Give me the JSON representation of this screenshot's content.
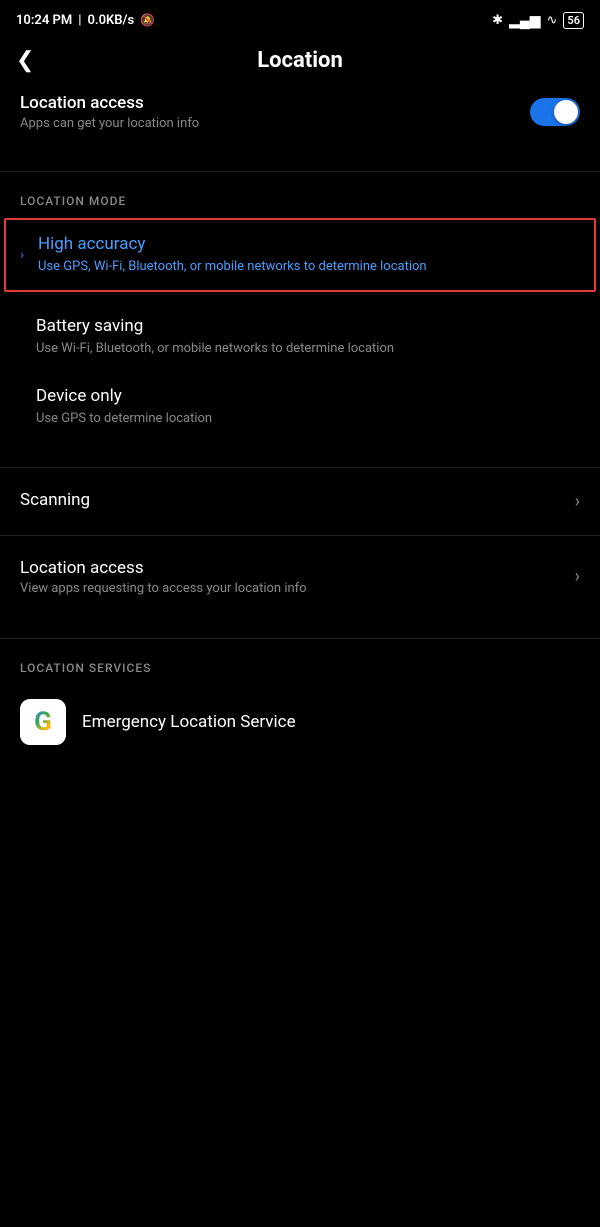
{
  "statusBar": {
    "time": "10:24 PM",
    "network": "0.0KB/s",
    "battery": "56"
  },
  "header": {
    "back_label": "‹",
    "title": "Location"
  },
  "locationAccess": {
    "title": "Location access",
    "subtitle": "Apps can get your location info",
    "toggle_on": true
  },
  "locationMode": {
    "section_label": "LOCATION MODE",
    "items": [
      {
        "id": "high-accuracy",
        "title": "High accuracy",
        "desc": "Use GPS, Wi-Fi, Bluetooth, or mobile networks to determine location",
        "selected": true
      },
      {
        "id": "battery-saving",
        "title": "Battery saving",
        "desc": "Use Wi-Fi, Bluetooth, or mobile networks to determine location",
        "selected": false
      },
      {
        "id": "device-only",
        "title": "Device only",
        "desc": "Use GPS to determine location",
        "selected": false
      }
    ]
  },
  "menuItems": [
    {
      "id": "scanning",
      "title": "Scanning",
      "subtitle": ""
    },
    {
      "id": "location-access-apps",
      "title": "Location access",
      "subtitle": "View apps requesting to access your location info"
    }
  ],
  "locationServices": {
    "section_label": "LOCATION SERVICES",
    "items": [
      {
        "id": "emergency-location",
        "title": "Emergency Location Service",
        "icon": "G"
      }
    ]
  },
  "icons": {
    "back": "❮",
    "chevron_right": "›",
    "chevron_left": "›"
  }
}
